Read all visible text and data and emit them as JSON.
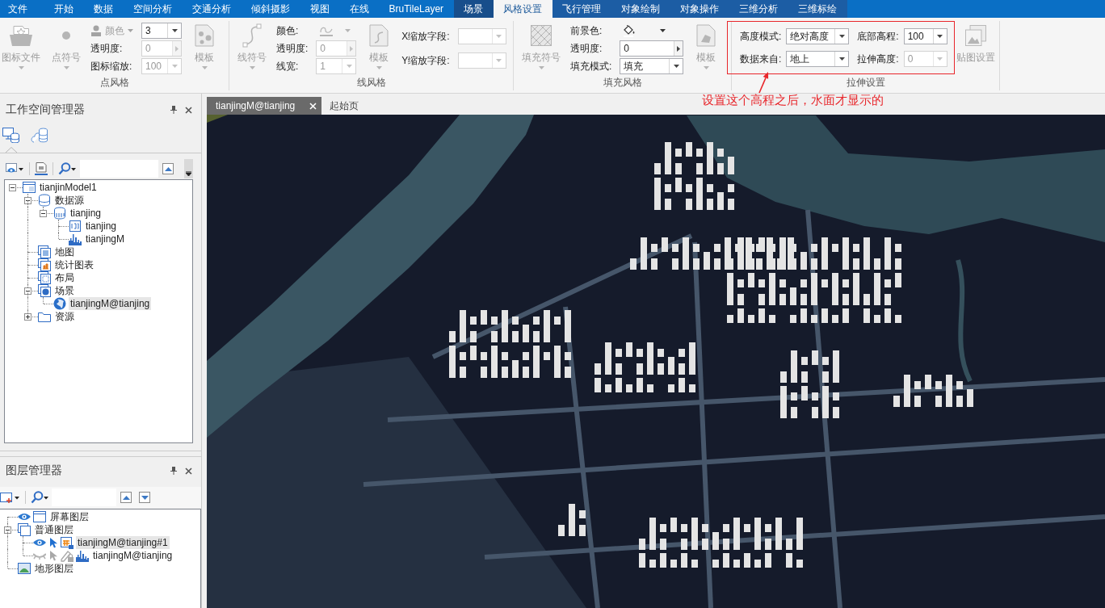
{
  "menu_tabs": [
    {
      "label": "文件",
      "kind": "main",
      "selected": false,
      "hovered": false
    },
    {
      "label": "开始",
      "kind": "main",
      "selected": false,
      "hovered": false
    },
    {
      "label": "数据",
      "kind": "main",
      "selected": false,
      "hovered": false
    },
    {
      "label": "空间分析",
      "kind": "main",
      "selected": false,
      "hovered": false
    },
    {
      "label": "交通分析",
      "kind": "main",
      "selected": false,
      "hovered": false
    },
    {
      "label": "倾斜摄影",
      "kind": "main",
      "selected": false,
      "hovered": false
    },
    {
      "label": "视图",
      "kind": "main",
      "selected": false,
      "hovered": false
    },
    {
      "label": "在线",
      "kind": "main",
      "selected": false,
      "hovered": false
    },
    {
      "label": "BruTileLayer",
      "kind": "main",
      "selected": false,
      "hovered": false
    },
    {
      "label": "场景",
      "kind": "scene",
      "selected": false,
      "hovered": true
    },
    {
      "label": "风格设置",
      "kind": "scene",
      "selected": true,
      "hovered": false
    },
    {
      "label": "飞行管理",
      "kind": "scene",
      "selected": false,
      "hovered": false
    },
    {
      "label": "对象绘制",
      "kind": "scene",
      "selected": false,
      "hovered": false
    },
    {
      "label": "对象操作",
      "kind": "scene",
      "selected": false,
      "hovered": false
    },
    {
      "label": "三维分析",
      "kind": "scene",
      "selected": false,
      "hovered": false
    },
    {
      "label": "三维标绘",
      "kind": "scene",
      "selected": false,
      "hovered": false
    }
  ],
  "ribbon": {
    "groups": [
      {
        "kind": "point",
        "title": "点风格",
        "columns": [
          {
            "kind": "icon_file",
            "label": "图标文件",
            "disabled": true,
            "has_menu": true
          },
          {
            "kind": "point_symbol",
            "label": "点符号",
            "disabled": true,
            "has_menu": true
          },
          {
            "kind": "labels",
            "items": [
              {
                "kind": "color_menu",
                "label": "颜色",
                "disabled": true
              },
              {
                "kind": "text",
                "label": "透明度:"
              },
              {
                "kind": "text",
                "label": "图标缩放:"
              }
            ]
          },
          {
            "kind": "fields",
            "items": [
              {
                "kind": "combo",
                "value": "3",
                "disabled": false
              },
              {
                "kind": "spin",
                "value": "0",
                "disabled": true
              },
              {
                "kind": "combo",
                "value": "100",
                "disabled": true
              }
            ]
          },
          {
            "kind": "template",
            "label": "模板",
            "disabled": true,
            "has_menu": true
          }
        ]
      },
      {
        "kind": "line",
        "title": "线风格",
        "columns": [
          {
            "kind": "line_symbol",
            "label": "线符号",
            "disabled": true,
            "has_menu": true
          },
          {
            "kind": "labels",
            "items": [
              {
                "kind": "text",
                "label": "颜色:"
              },
              {
                "kind": "text",
                "label": "透明度:"
              },
              {
                "kind": "text",
                "label": "线宽:"
              }
            ]
          },
          {
            "kind": "fields",
            "items": [
              {
                "kind": "line_color",
                "disabled": true
              },
              {
                "kind": "spin",
                "value": "0",
                "disabled": true
              },
              {
                "kind": "combo",
                "value": "1",
                "disabled": true
              }
            ]
          },
          {
            "kind": "template",
            "label": "模板",
            "disabled": true,
            "has_menu": true
          },
          {
            "kind": "labels",
            "items": [
              {
                "kind": "text",
                "label": "X缩放字段:"
              },
              {
                "kind": "text",
                "label": "Y缩放字段:"
              }
            ]
          },
          {
            "kind": "fields",
            "items": [
              {
                "kind": "combo",
                "disabled": true
              },
              {
                "kind": "combo",
                "disabled": true
              }
            ]
          }
        ]
      },
      {
        "kind": "fill",
        "title": "填充风格",
        "columns": [
          {
            "kind": "fill_symbol",
            "label": "填充符号",
            "disabled": true,
            "has_menu": true
          },
          {
            "kind": "labels",
            "items": [
              {
                "kind": "text",
                "label": "前景色:"
              },
              {
                "kind": "text",
                "label": "透明度:"
              },
              {
                "kind": "text",
                "label": "填充模式:"
              }
            ]
          },
          {
            "kind": "fields",
            "items": [
              {
                "kind": "fill_color",
                "disabled": false
              },
              {
                "kind": "spin",
                "value": "0",
                "disabled": false
              },
              {
                "kind": "combo",
                "value": "填充",
                "disabled": false
              }
            ]
          },
          {
            "kind": "template",
            "label": "模板",
            "disabled": true,
            "has_menu": true
          }
        ]
      },
      {
        "kind": "extrude",
        "title": "拉伸设置",
        "boxed_columns": [
          {
            "kind": "labels",
            "items": [
              {
                "kind": "text",
                "label": "高度模式:"
              },
              {
                "kind": "text",
                "label": "数据来自:"
              }
            ]
          },
          {
            "kind": "fields",
            "items": [
              {
                "kind": "combo",
                "value": "绝对高度",
                "disabled": false
              },
              {
                "kind": "combo",
                "value": "地上",
                "disabled": false
              }
            ]
          },
          {
            "kind": "labels",
            "items": [
              {
                "kind": "text",
                "label": "底部高程:"
              },
              {
                "kind": "text",
                "label": "拉伸高度:"
              }
            ]
          },
          {
            "kind": "fields",
            "items": [
              {
                "kind": "combo",
                "value": "100",
                "disabled": false
              },
              {
                "kind": "combo",
                "value": "0",
                "disabled": true
              }
            ]
          }
        ],
        "columns": [
          {
            "kind": "texture",
            "label": "贴图设置",
            "disabled": true,
            "has_menu": false
          }
        ]
      }
    ]
  },
  "annotation": {
    "text": "设置这个高程之后，水面才显示的"
  },
  "workspace_panel": {
    "title": "工作空间管理器",
    "view_tabs": [
      {
        "kind": "workspace",
        "selected": true
      },
      {
        "kind": "cloud",
        "selected": false
      }
    ],
    "tree": [
      {
        "label": "tianjinModel1",
        "kind": "workspace",
        "expanded": true,
        "selected": false,
        "children": [
          {
            "label": "数据源",
            "kind": "datasources",
            "expanded": true,
            "selected": false,
            "children": [
              {
                "label": "tianjing",
                "kind": "udb",
                "expanded": true,
                "selected": false,
                "children": [
                  {
                    "label": "tianjing",
                    "kind": "cad",
                    "selected": false
                  },
                  {
                    "label": "tianjingM",
                    "kind": "model",
                    "selected": false
                  }
                ]
              }
            ]
          },
          {
            "label": "地图",
            "kind": "maps",
            "selected": false
          },
          {
            "label": "统计图表",
            "kind": "charts",
            "selected": false
          },
          {
            "label": "布局",
            "kind": "layouts",
            "selected": false
          },
          {
            "label": "场景",
            "kind": "scenes",
            "expanded": true,
            "selected": false,
            "children": [
              {
                "label": "tianjingM@tianjing",
                "kind": "scene",
                "selected": true
              }
            ]
          },
          {
            "label": "资源",
            "kind": "resources",
            "expanded": false,
            "selected": false
          }
        ]
      }
    ]
  },
  "layer_panel": {
    "title": "图层管理器",
    "tree": [
      {
        "label": "屏幕图层",
        "kind": "screen",
        "visible": true,
        "selected": false
      },
      {
        "label": "普通图层",
        "kind": "group",
        "expanded": true,
        "selected": false,
        "children": [
          {
            "label": "tianjingM@tianjing#1",
            "kind": "vector",
            "visible": true,
            "selectable": true,
            "locked": false,
            "selected": true
          },
          {
            "label": "tianjingM@tianjing",
            "kind": "model",
            "visible": false,
            "selectable": false,
            "locked": true,
            "selected": false
          }
        ]
      },
      {
        "label": "地形图层",
        "kind": "terrain",
        "selected": false
      }
    ]
  },
  "document_tabs": [
    {
      "label": "tianjingM@tianjing",
      "selected": true
    },
    {
      "label": "起始页",
      "selected": false
    }
  ]
}
